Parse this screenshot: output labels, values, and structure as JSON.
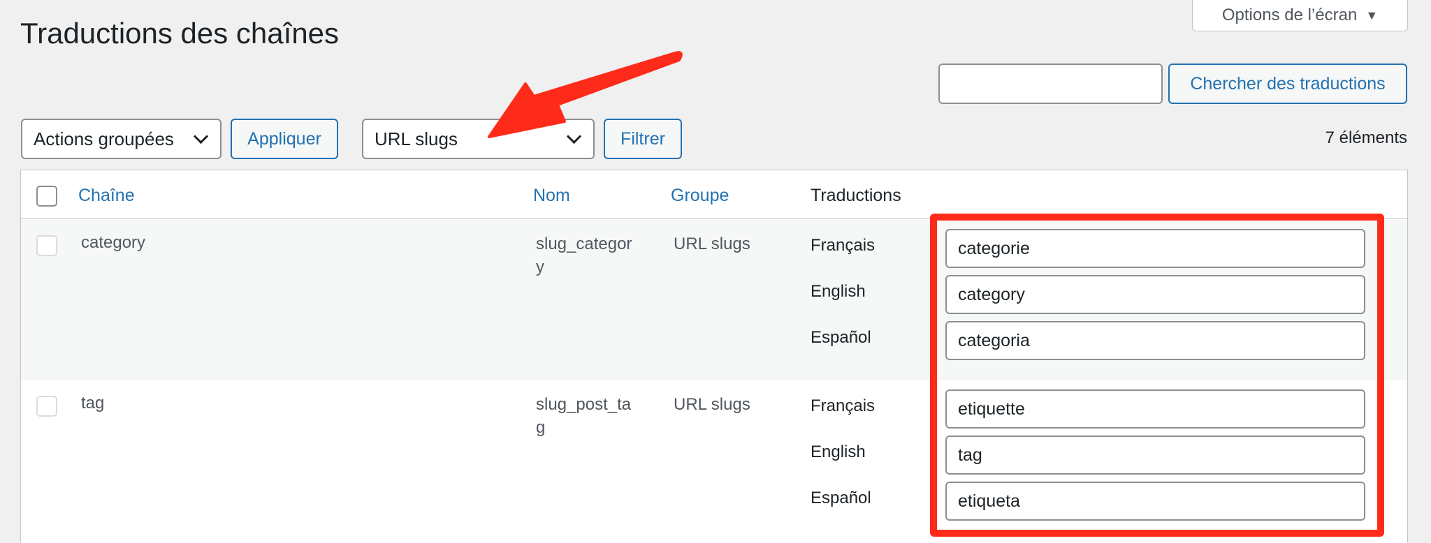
{
  "screen_options": {
    "label": "Options de l’écran",
    "caret": "▼"
  },
  "page_title": "Traductions des chaînes",
  "search": {
    "value": "",
    "placeholder": "",
    "button_label": "Chercher des traductions"
  },
  "bulk_actions": {
    "selected": "Actions groupées",
    "apply_label": "Appliquer"
  },
  "group_filter": {
    "selected": "URL slugs",
    "filter_label": "Filtrer"
  },
  "item_count": "7 éléments",
  "table": {
    "columns": {
      "string": "Chaîne",
      "name": "Nom",
      "group": "Groupe",
      "translations": "Traductions"
    },
    "rows": [
      {
        "string": "category",
        "name_line1": "slug_categor",
        "name_line2": "y",
        "group": "URL slugs",
        "translations": [
          {
            "lang": "Français",
            "value": "categorie"
          },
          {
            "lang": "English",
            "value": "category"
          },
          {
            "lang": "Español",
            "value": "categoria"
          }
        ]
      },
      {
        "string": "tag",
        "name_line1": "slug_post_ta",
        "name_line2": "g",
        "group": "URL slugs",
        "translations": [
          {
            "lang": "Français",
            "value": "etiquette"
          },
          {
            "lang": "English",
            "value": "tag"
          },
          {
            "lang": "Español",
            "value": "etiqueta"
          }
        ]
      }
    ]
  },
  "colors": {
    "accent": "#2271b1",
    "annotation_red": "#ff2b1a",
    "background": "#f0f0f1"
  }
}
